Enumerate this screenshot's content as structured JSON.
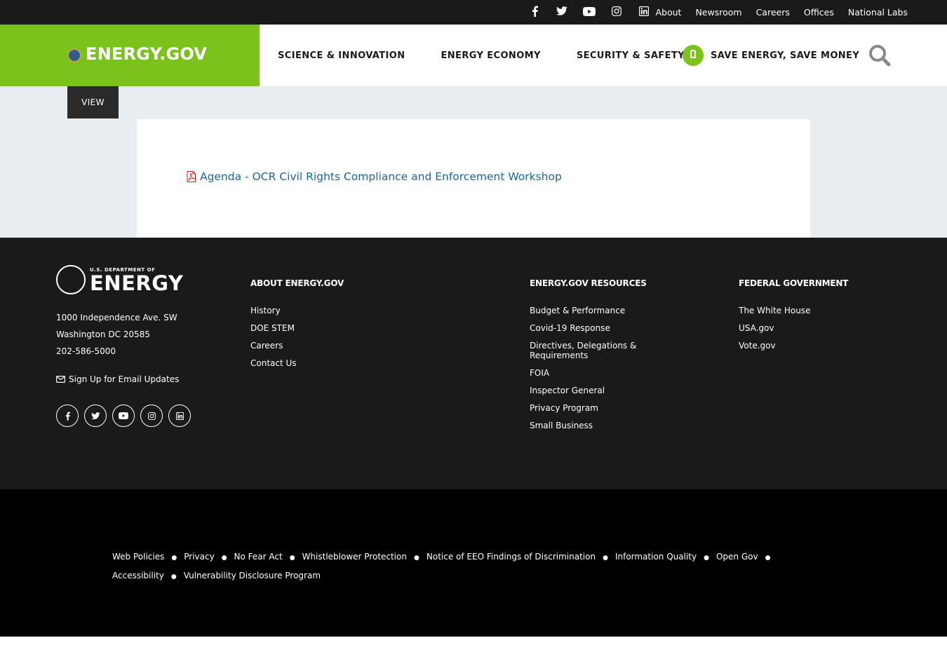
{
  "utility": {
    "social": [
      "facebook-icon",
      "twitter-icon",
      "youtube-icon",
      "instagram-icon",
      "linkedin-icon"
    ],
    "links": [
      "About",
      "Newsroom",
      "Careers",
      "Offices",
      "National Labs"
    ]
  },
  "header": {
    "brand": "ENERGY.GOV",
    "nav": [
      "SCIENCE & INNOVATION",
      "ENERGY ECONOMY",
      "SECURITY & SAFETY"
    ],
    "save_energy": "SAVE ENERGY, SAVE MONEY",
    "brand_color": "#7ac31c"
  },
  "main": {
    "view_tab": "VIEW",
    "document_link": "Agenda - OCR Civil Rights Compliance and Enforcement Workshop",
    "link_color": "#1866a8"
  },
  "footer": {
    "logo_dept": "U.S. DEPARTMENT OF",
    "logo_energy": "ENERGY",
    "address_line1": "1000 Independence Ave. SW",
    "address_line2": "Washington DC 20585",
    "phone": "202-586-5000",
    "email_updates": "Sign Up for Email Updates",
    "columns": [
      {
        "title": "ABOUT ENERGY.GOV",
        "links": [
          "History",
          "DOE STEM",
          "Careers",
          "Contact Us"
        ]
      },
      {
        "title": "ENERGY.GOV RESOURCES",
        "links": [
          "Budget & Performance",
          "Covid-19 Response",
          "Directives, Delegations & Requirements",
          "FOIA",
          "Inspector General",
          "Privacy Program",
          "Small Business"
        ]
      },
      {
        "title": "FEDERAL GOVERNMENT",
        "links": [
          "The White House",
          "USA.gov",
          "Vote.gov"
        ]
      }
    ]
  },
  "legal": {
    "links": [
      "Web Policies",
      "Privacy",
      "No Fear Act",
      "Whistleblower Protection",
      "Notice of EEO Findings of Discrimination",
      "Information Quality",
      "Open Gov",
      "Accessibility",
      "Vulnerability Disclosure Program"
    ]
  }
}
